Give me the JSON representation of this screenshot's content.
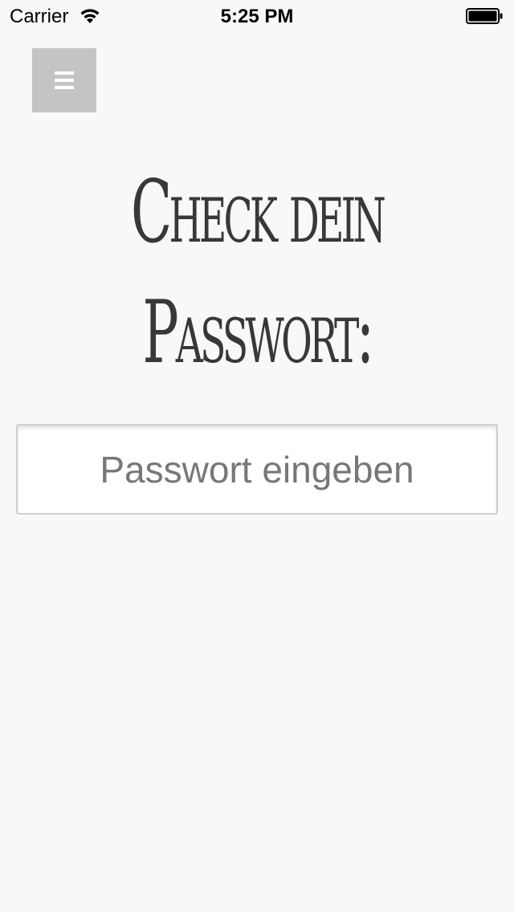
{
  "status_bar": {
    "carrier": "Carrier",
    "time": "5:25 PM",
    "icons": [
      "wifi-icon",
      "battery-icon"
    ]
  },
  "menu_button": {
    "icon": "hamburger-menu-icon",
    "color": "#c4c4c4"
  },
  "headline": {
    "line1": "Check dein",
    "line2": "Passwort:"
  },
  "password_field": {
    "value": "",
    "placeholder": "Passwort eingeben"
  },
  "colors": {
    "background": "#f8f8f8",
    "text": "#383838",
    "placeholder": "#777777"
  }
}
